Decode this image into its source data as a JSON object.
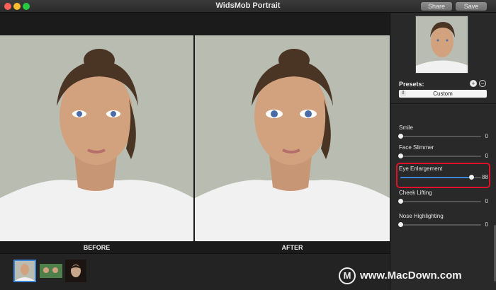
{
  "window": {
    "title": "WidsMob Portrait",
    "share_label": "Share",
    "save_label": "Save"
  },
  "viewer": {
    "before_label": "BEFORE",
    "after_label": "AFTER"
  },
  "sidebar": {
    "presets_label": "Presets:",
    "add_icon": "plus-circle-icon",
    "remove_icon": "minus-circle-icon",
    "preset_value": "Custom",
    "sliders": [
      {
        "label": "Smile",
        "value": "0",
        "level": 0
      },
      {
        "label": "Face Slimmer",
        "value": "0",
        "level": 0
      },
      {
        "label": "Eye Enlargement",
        "value": "88",
        "level": 0.88
      },
      {
        "label": "Cheek Lifting",
        "value": "0",
        "level": 0
      },
      {
        "label": "Nose Highlighting",
        "value": "0",
        "level": 0
      }
    ]
  },
  "watermark": {
    "text": "www.MacDown.com",
    "logo": "M"
  },
  "colors": {
    "accent": "#3d86d8",
    "highlight": "#e0102a"
  }
}
